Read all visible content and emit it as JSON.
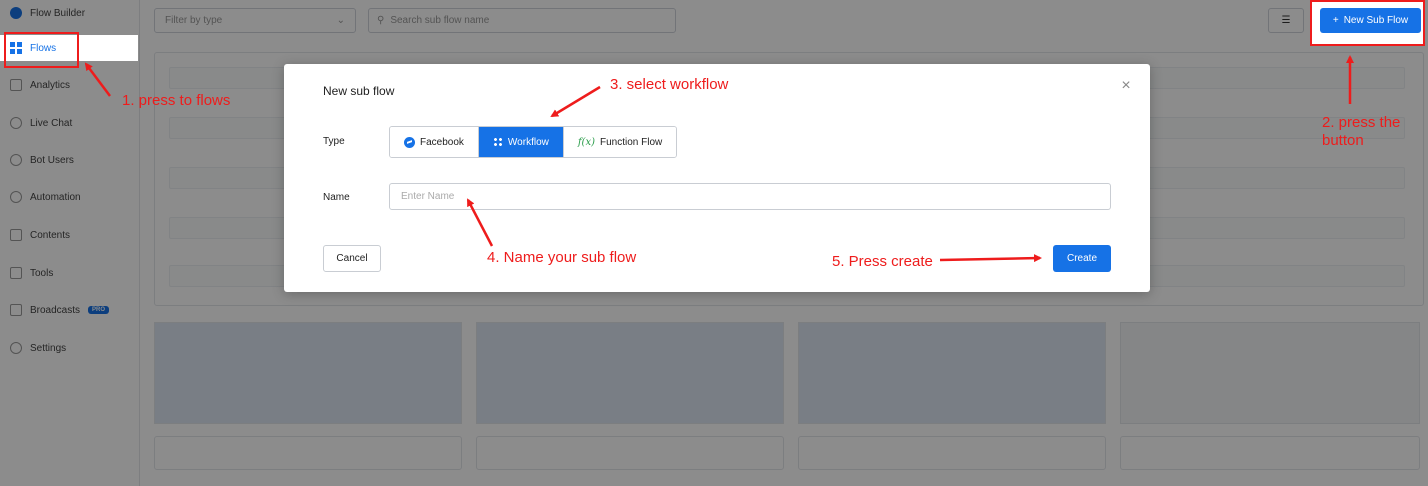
{
  "sidebar": {
    "items": [
      {
        "label": "Flow Builder",
        "icon": "facebook-messenger-icon"
      },
      {
        "label": "Flows",
        "icon": "grid-icon",
        "active": true
      },
      {
        "label": "Analytics",
        "icon": "chart-icon"
      },
      {
        "label": "Live Chat",
        "icon": "chat-icon"
      },
      {
        "label": "Bot Users",
        "icon": "user-icon"
      },
      {
        "label": "Automation",
        "icon": "automation-icon"
      },
      {
        "label": "Contents",
        "icon": "contents-icon"
      },
      {
        "label": "Tools",
        "icon": "tools-icon"
      },
      {
        "label": "Broadcasts",
        "icon": "megaphone-icon",
        "badge": "PRO"
      },
      {
        "label": "Settings",
        "icon": "gear-icon"
      }
    ]
  },
  "toolbar": {
    "filter_placeholder": "Filter by type",
    "search_placeholder": "Search sub flow name",
    "new_button_label": "New Sub Flow",
    "new_button_icon": "plus-icon",
    "view_icon": "list-icon"
  },
  "modal": {
    "title": "New sub flow",
    "type_label": "Type",
    "type_options": [
      {
        "label": "Facebook",
        "icon": "facebook-messenger-icon",
        "selected": false
      },
      {
        "label": "Workflow",
        "icon": "workflow-icon",
        "selected": true
      },
      {
        "label": "Function Flow",
        "icon": "function-icon",
        "selected": false
      }
    ],
    "function_icon_text": "f(x)",
    "name_label": "Name",
    "name_placeholder": "Enter Name",
    "cancel_label": "Cancel",
    "create_label": "Create"
  },
  "annotations": {
    "step1": "1. press to flows",
    "step2_line1": "2. press the",
    "step2_line2": "button",
    "step3": "3. select workflow",
    "step4": "4. Name your sub flow",
    "step5": "5. Press create"
  },
  "colors": {
    "accent": "#1672e6",
    "annotation": "#ee1c1c",
    "function_icon": "#2a9d4a"
  }
}
